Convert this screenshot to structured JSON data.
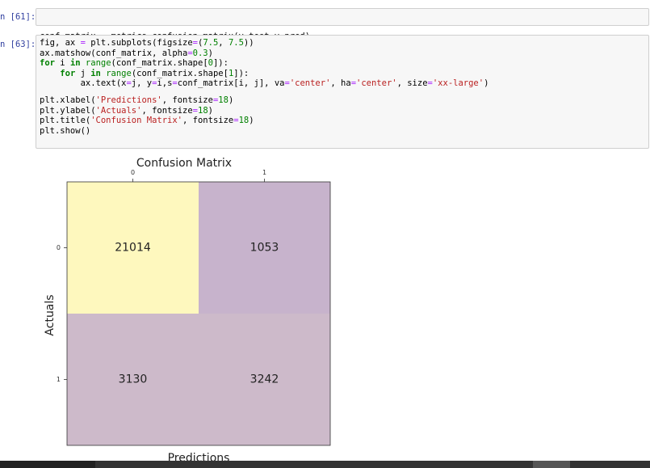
{
  "cells": [
    {
      "prompt": "n [61]:",
      "code": "conf_matrix = metrics.confusion_matrix(y_test,y_pred)"
    },
    {
      "prompt": "n [63]:",
      "lines": [
        "fig, ax = plt.subplots(figsize=(7.5, 7.5))",
        "ax.matshow(conf_matrix, alpha=0.3)",
        "for i in range(conf_matrix.shape[0]):",
        "    for j in range(conf_matrix.shape[1]):",
        "        ax.text(x=j, y=i,s=conf_matrix[i, j], va='center', ha='center', size='xx-large')",
        "",
        "plt.xlabel('Predictions', fontsize=18)",
        "plt.ylabel('Actuals', fontsize=18)",
        "plt.title('Confusion Matrix', fontsize=18)",
        "plt.show()"
      ]
    }
  ],
  "chart_data": {
    "type": "heatmap",
    "title": "Confusion Matrix",
    "xlabel": "Predictions",
    "ylabel": "Actuals",
    "x_ticks": [
      "0",
      "1"
    ],
    "y_ticks": [
      "0",
      "1"
    ],
    "matrix": [
      [
        21014,
        1053
      ],
      [
        3130,
        3242
      ]
    ],
    "colormap": [
      "#440154",
      "#fde725"
    ],
    "alpha": 0.3
  },
  "colors": {
    "cell_bg": "#f7f7f7",
    "prompt": "#303f9f",
    "keyword": "#008000",
    "string": "#ba2121"
  }
}
